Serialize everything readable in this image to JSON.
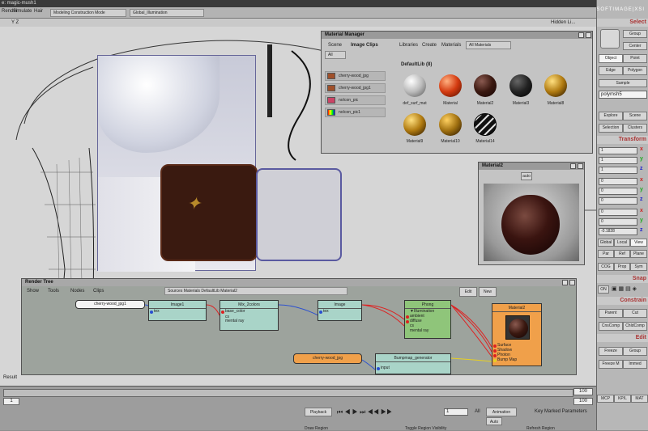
{
  "window": {
    "title": "e: magic-mush1"
  },
  "menubar": {
    "items": [
      "Render",
      "Simulate",
      "Hair"
    ],
    "mode": "Modeling Construction Mode",
    "pass": "Global_Illumination",
    "logo": "SOFTIMAGE|XSI"
  },
  "viewport": {
    "label": "Y Z",
    "hidden": "Hidden Li...",
    "result": "Result"
  },
  "material_manager": {
    "title": "Material Manager",
    "left_tabs": [
      "Scene",
      "Image Clips"
    ],
    "filter": "All",
    "clips": [
      "cherry-wood_jpg",
      "cherry-wood_jpg1",
      "noIcon_pic",
      "noIcon_pic1"
    ],
    "top_menu": [
      "Libraries",
      "Create",
      "Materials",
      "All Materials"
    ],
    "library": "DefaultLib (8)",
    "materials": [
      "def_surf_mat",
      "Material",
      "Material2",
      "Material3",
      "Material8",
      "Material9",
      "Material10",
      "Material14"
    ]
  },
  "preview": {
    "title": "Material2",
    "auto": "auto"
  },
  "render_tree": {
    "title": "Render Tree",
    "menu": [
      "Show",
      "Tools",
      "Nodes",
      "Clips"
    ],
    "path": "Sources Materials DefaultLib Material2",
    "edit": "Edit",
    "new": "New",
    "nodes": {
      "clip1": "cherry-wood_jpg1",
      "image1": {
        "title": "Image1",
        "ports": [
          "tex"
        ]
      },
      "mix": {
        "title": "Mix_2colors",
        "ports": [
          "base_color",
          "cs",
          "mental ray"
        ]
      },
      "image": {
        "title": "Image",
        "ports": [
          "tex"
        ]
      },
      "phong": {
        "title": "Phong",
        "ports": [
          "▼Illumination",
          "ambient",
          "diffuse",
          "cs",
          "mental ray"
        ]
      },
      "material": {
        "title": "Material2",
        "ports": [
          "Surface",
          "Shadow",
          "Photon",
          "Bump Map"
        ]
      },
      "clip2": "cherry-wood_jpg",
      "bump": {
        "title": "Bumpmap_generator",
        "ports": [
          "input"
        ]
      }
    }
  },
  "right_panel": {
    "select": "Select",
    "select_buttons": [
      "Group",
      "Center",
      "Object",
      "Point",
      "Edge",
      "Polygon",
      "Sample"
    ],
    "object_name": "polymsh5",
    "explore": [
      "Explore",
      "Scene",
      "Selection",
      "Clusters"
    ],
    "transform": "Transform",
    "fields": [
      "1",
      "1",
      "1",
      "0",
      "0",
      "0",
      "0",
      "0",
      "-0.1828"
    ],
    "axes": [
      "x",
      "y",
      "z",
      "x",
      "y",
      "z",
      "x",
      "y",
      "z"
    ],
    "view_buttons": [
      "Global",
      "Local",
      "View",
      "Par",
      "Ref",
      "Plane",
      "COG",
      "Prop",
      "Sym"
    ],
    "snap": "Snap",
    "snap_on": "ON",
    "constrain": "Constrain",
    "constrain_buttons": [
      "Parent",
      "Cut",
      "CnsComp",
      "ChldComp"
    ],
    "edit": "Edit",
    "edit_buttons": [
      "Freeze",
      "Group",
      "Freeze M",
      "Immed"
    ],
    "bottom_tabs": [
      "MCP",
      "KP/L",
      "MAT"
    ]
  },
  "timeline": {
    "start": "1",
    "end": "100",
    "end2": "100",
    "playback": "Playback",
    "frame": "1",
    "all": "All",
    "animation": "Animation",
    "auto": "Auto",
    "key_params": "Key Marked Parameters",
    "status": [
      "Draw Region",
      "Toggle Region Visibility",
      "Refresh Region"
    ]
  }
}
